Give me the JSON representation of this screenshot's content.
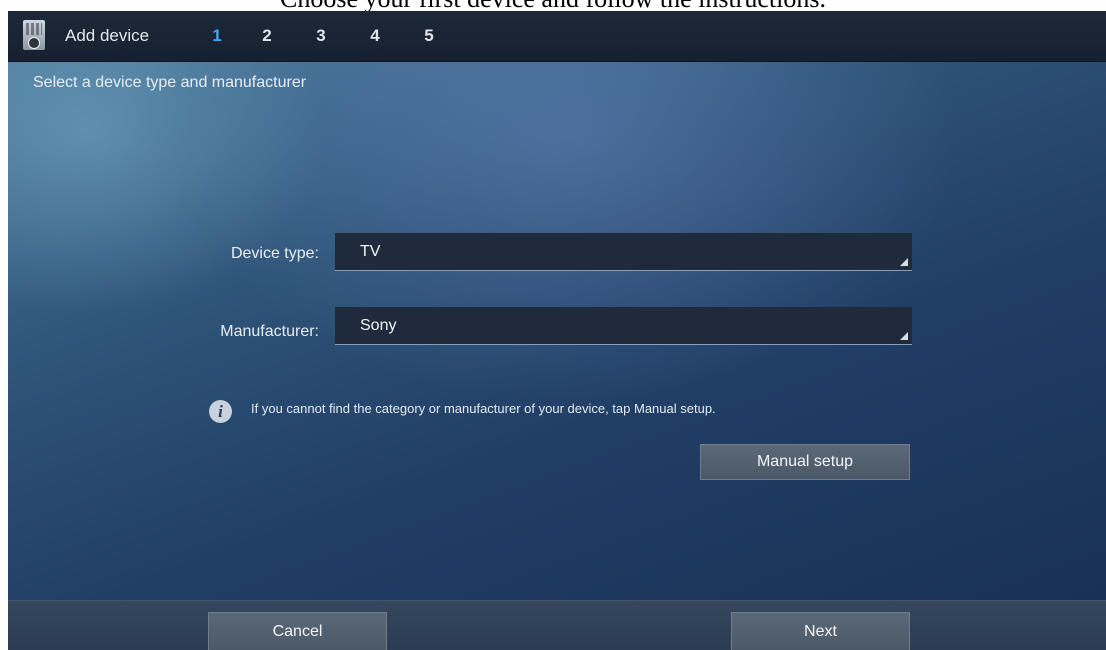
{
  "caption": "Choose your first device and follow the instructions.",
  "header": {
    "title": "Add device",
    "steps": [
      "1",
      "2",
      "3",
      "4",
      "5"
    ],
    "active_step": "1"
  },
  "subtitle": "Select a device type and manufacturer",
  "form": {
    "device_type_label": "Device type:",
    "device_type_value": "TV",
    "manufacturer_label": "Manufacturer:",
    "manufacturer_value": "Sony"
  },
  "info": {
    "icon": "info-icon",
    "text": "If you cannot find the category or manufacturer of your device, tap Manual setup."
  },
  "manual_setup_label": "Manual setup",
  "footer": {
    "cancel_label": "Cancel",
    "next_label": "Next"
  },
  "colors": {
    "active_step": "#3fa9f5"
  }
}
